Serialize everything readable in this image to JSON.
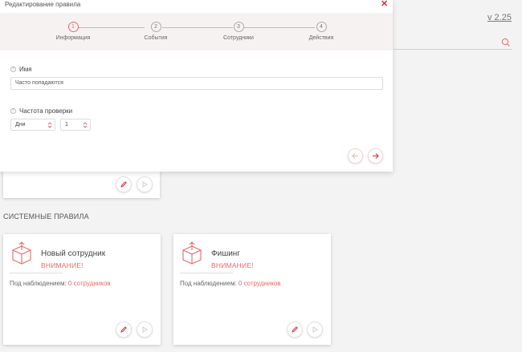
{
  "header": {
    "version": "v 2.25"
  },
  "modal": {
    "title": "Редактирование правила",
    "close_glyph": "✕",
    "steps": [
      {
        "number": "1",
        "label": "Информация"
      },
      {
        "number": "2",
        "label": "События"
      },
      {
        "number": "3",
        "label": "Сотрудники"
      },
      {
        "number": "4",
        "label": "Действия"
      }
    ],
    "name_field": {
      "label": "Имя",
      "value": "Часто попадаются"
    },
    "frequency": {
      "label": "Частота проверки",
      "unit": "Дни",
      "count": "1"
    }
  },
  "system_rules": {
    "section_title": "СИСТЕМНЫЕ ПРАВИЛА",
    "cards": [
      {
        "name": "Новый сотрудник",
        "warning": "ВНИМАНИЕ!",
        "watch_label": "Под наблюдением:",
        "watch_value": "0 сотрудников"
      },
      {
        "name": "Фишинг",
        "warning": "ВНИМАНИЕ!",
        "watch_label": "Под наблюдением:",
        "watch_value": "0 сотрудников"
      }
    ]
  },
  "colors": {
    "accent": "#e86a6a",
    "close": "#d32f2f",
    "stepper_bg": "#f7f2f2",
    "page_bg": "#f3f3f3"
  }
}
